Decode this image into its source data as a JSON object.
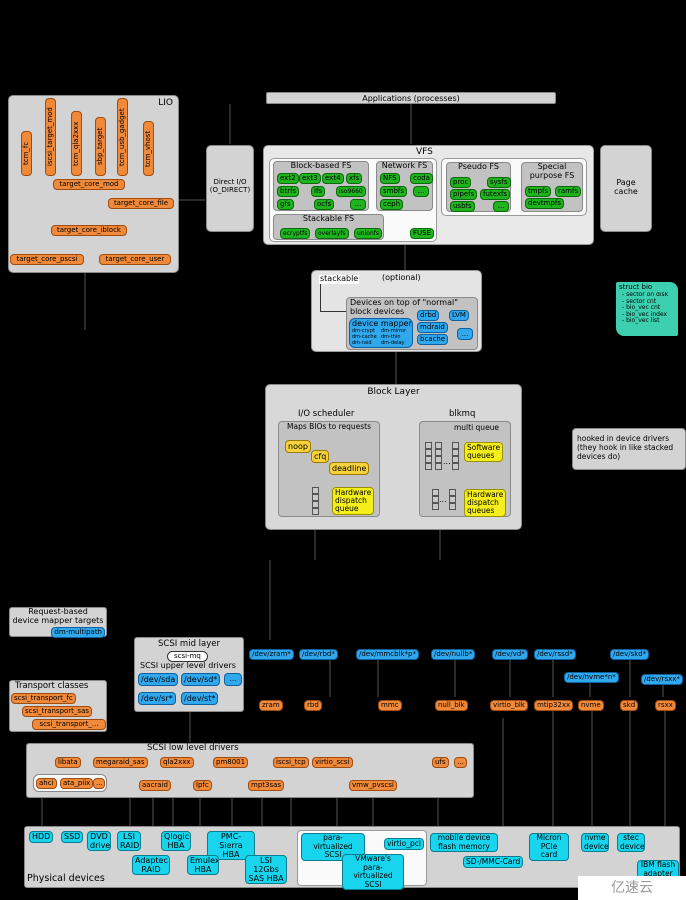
{
  "applications": "Applications (processes)",
  "lio": {
    "title": "LIO",
    "fabric_modules": [
      "tcm_fc",
      "iscsi_target_mod",
      "tcm_qla2xxx",
      "sbp_target",
      "tcm_usb_gadget",
      "tcm_vhost"
    ],
    "core": "target_core_mod",
    "backends": [
      "target_core_file",
      "target_core_iblock",
      "target_core_pscsi",
      "target_core_user"
    ]
  },
  "direct_io": {
    "line1": "Direct I/O",
    "line2": "(O_DIRECT)"
  },
  "vfs": {
    "title": "VFS",
    "block_based": {
      "title": "Block-based FS",
      "items": [
        "ext2",
        "ext3",
        "ext4",
        "xfs",
        "btrfs",
        "ifs",
        "iso9660",
        "gfs",
        "ocfs",
        "..."
      ]
    },
    "network": {
      "title": "Network FS",
      "items": [
        "NFS",
        "coda",
        "smbfs",
        "...",
        "ceph"
      ]
    },
    "stackable": {
      "title": "Stackable FS",
      "items": [
        "ecryptfs",
        "overlayfs",
        "unionfs"
      ]
    },
    "fuse": "FUSE",
    "pseudo": {
      "title": "Pseudo FS",
      "items": [
        "proc",
        "sysfs",
        "pipefs",
        "futexfs",
        "usbfs",
        "..."
      ]
    },
    "special": {
      "title_line1": "Special",
      "title_line2": "purpose FS",
      "items": [
        "tmpfs",
        "ramfs",
        "devtmpfs"
      ]
    }
  },
  "page_cache": {
    "line1": "Page",
    "line2": "cache"
  },
  "stacked": {
    "stackable": "stackable",
    "optional": "(optional)",
    "title_line1": "Devices on top of \"normal\"",
    "title_line2": "block devices",
    "device_mapper": {
      "title": "device mapper",
      "targets": [
        "dm-crypt",
        "dm-mirror",
        "dm-cache",
        "dm-thin",
        "dm-raid",
        "dm-delay"
      ]
    },
    "items": [
      "drbd",
      "LVM",
      "mdraid",
      "bcache",
      "..."
    ]
  },
  "struct_bio": {
    "title": "struct bio",
    "fields": [
      "- sector on disk",
      "- sector cnt",
      "- bio_vec cnt",
      "- bio_vec index",
      "- bio_vec list"
    ]
  },
  "block_layer": {
    "title": "Block Layer",
    "io_scheduler": {
      "title": "I/O scheduler",
      "subtitle": "Maps BIOs to requests",
      "schedulers": [
        "noop",
        "cfq",
        "deadline"
      ],
      "hw_queue": [
        "Hardware",
        "dispatch",
        "queue"
      ]
    },
    "blkmq": {
      "title": "blkmq",
      "subtitle": "multi queue",
      "sw_queues": [
        "Software",
        "queues"
      ],
      "hw_queues": [
        "Hardware",
        "dispatch",
        "queues"
      ],
      "ellipsis": "..."
    }
  },
  "hooked_note": [
    "hooked in device drivers",
    "(they hook in like stacked",
    "devices do)"
  ],
  "request_dm": {
    "line1": "Request-based",
    "line2": "device mapper targets",
    "item": "dm-multipath"
  },
  "scsi_mid": {
    "title": "SCSI mid layer",
    "mq": "scsi-mq",
    "upper_title": "SCSI upper level drivers",
    "upper": [
      "/dev/sda",
      "/dev/sd*",
      "...",
      "/dev/sr*",
      "/dev/st*"
    ]
  },
  "transport": {
    "title": "Transport classes",
    "items": [
      "scsi_transport_fc",
      "scsi_transport_sas",
      "scsi_transport_..."
    ]
  },
  "dev_nodes": [
    "/dev/zram*",
    "/dev/rbd*",
    "/dev/mmcblk*p*",
    "/dev/nullb*",
    "/dev/vd*",
    "/dev/rssd*",
    "/dev/skd*",
    "/dev/nvme*n*",
    "/dev/rsxx*"
  ],
  "block_drivers": [
    "zram",
    "rbd",
    "mmc",
    "null_blk",
    "virtio_blk",
    "mtip32xx",
    "nvme",
    "skd",
    "rsxx"
  ],
  "scsi_low": {
    "title": "SCSI low level drivers",
    "top": [
      "libata",
      "megaraid_sas",
      "qla2xxx",
      "pm8001",
      "iscsi_tcp",
      "virtio_scsi",
      "ufs",
      "..."
    ],
    "libata_group": [
      "ahci",
      "ata_piix",
      "..."
    ],
    "second": [
      "aacraid",
      "lpfc",
      "mpt3sas",
      "vmw_pvscsi"
    ]
  },
  "physical": {
    "title": "Physical devices",
    "row1": [
      "HDD",
      "SSD",
      "DVD drive",
      "LSI RAID",
      "Qlogic HBA",
      "PMC-Sierra HBA"
    ],
    "row2": [
      "Adaptec RAID",
      "Emulex HBA",
      "LSI 12Gbs SAS HBA"
    ],
    "virtual": [
      "para-virtualized SCSI",
      "virtio_pci",
      "VMware's para-virtualized SCSI"
    ],
    "others": [
      "mobile device flash memory",
      "SD-/MMC-Card",
      "Micron PCIe card",
      "nvme device",
      "stec device",
      "IBM flash adapter"
    ]
  },
  "watermark": "亿速云"
}
